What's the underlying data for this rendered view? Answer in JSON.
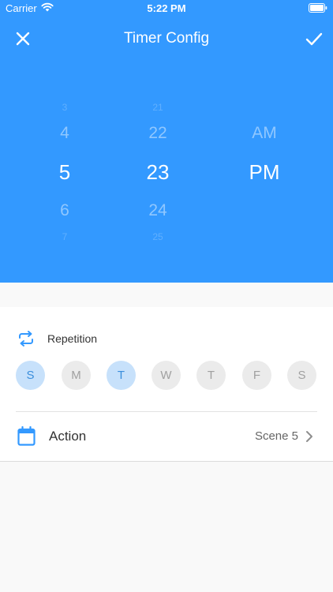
{
  "status_bar": {
    "carrier": "Carrier",
    "time": "5:22 PM"
  },
  "header": {
    "title": "Timer Config",
    "close_icon": "close-icon",
    "confirm_icon": "checkmark-icon",
    "background_color": "#3399ff"
  },
  "picker": {
    "hours": [
      "3",
      "4",
      "5",
      "6",
      "7"
    ],
    "selected_hour": "5",
    "minutes": [
      "21",
      "22",
      "23",
      "24",
      "25"
    ],
    "selected_minute": "23",
    "periods": [
      "AM",
      "PM"
    ],
    "selected_period": "PM"
  },
  "repetition": {
    "label": "Repetition",
    "icon": "repeat-icon",
    "days": [
      {
        "label": "S",
        "active": true
      },
      {
        "label": "M",
        "active": false
      },
      {
        "label": "T",
        "active": true
      },
      {
        "label": "W",
        "active": false
      },
      {
        "label": "T",
        "active": false
      },
      {
        "label": "F",
        "active": false
      },
      {
        "label": "S",
        "active": false
      }
    ],
    "active_color": "#c7e1fb"
  },
  "action": {
    "label": "Action",
    "value": "Scene 5",
    "icon": "calendar-icon"
  }
}
